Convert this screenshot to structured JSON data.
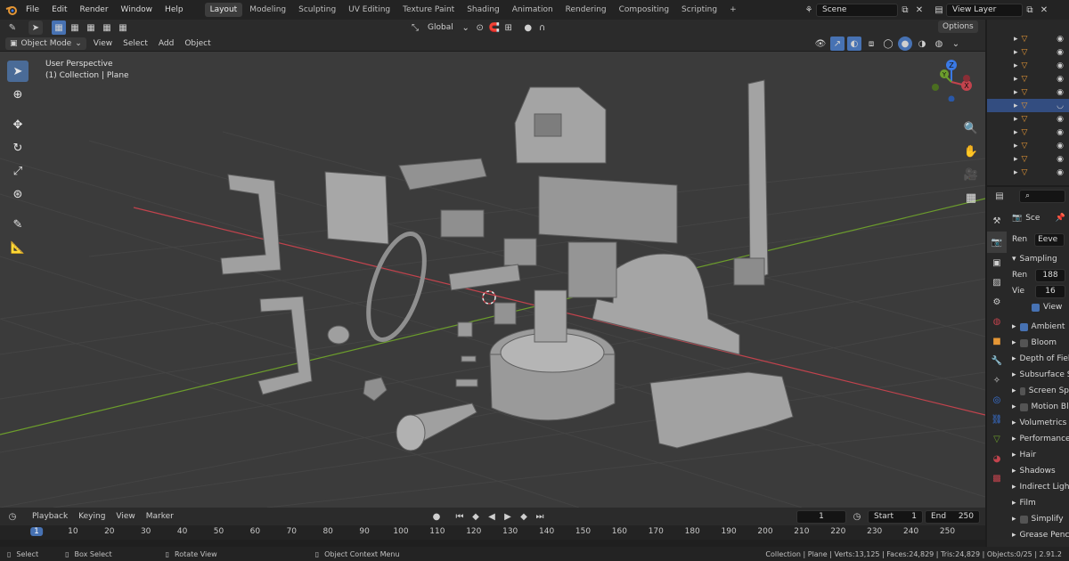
{
  "top_menu": [
    "File",
    "Edit",
    "Render",
    "Window",
    "Help"
  ],
  "workspaces": [
    {
      "label": "Layout",
      "active": true
    },
    {
      "label": "Modeling"
    },
    {
      "label": "Sculpting"
    },
    {
      "label": "UV Editing"
    },
    {
      "label": "Texture Paint"
    },
    {
      "label": "Shading"
    },
    {
      "label": "Animation"
    },
    {
      "label": "Rendering"
    },
    {
      "label": "Compositing"
    },
    {
      "label": "Scripting"
    }
  ],
  "add_workspace": "+",
  "scene": "Scene",
  "view_layer": "View Layer",
  "viewport_header": {
    "mode": "Object Mode",
    "menus": [
      "View",
      "Select",
      "Add",
      "Object"
    ],
    "transform_orientation": "Global",
    "options": "Options"
  },
  "overlay_text": {
    "perspective": "User Perspective",
    "collection": "(1) Collection | Plane"
  },
  "gizmo": {
    "x": "X",
    "y": "Y",
    "z": "Z"
  },
  "properties": {
    "tab_label": "Sce",
    "render_label": "Ren",
    "render_engine": "Eeve",
    "sampling_label": "Sampling",
    "render_samples_label": "Ren",
    "render_samples": "188",
    "viewport_samples_label": "Vie",
    "viewport_samples": "16",
    "viewport_denoise": "View",
    "sections": [
      {
        "label": "Ambient",
        "checkbox": true,
        "checked": true
      },
      {
        "label": "Bloom",
        "checkbox": true,
        "checked": false
      },
      {
        "label": "Depth of Fiel"
      },
      {
        "label": "Subsurface S"
      },
      {
        "label": "Screen Sp",
        "checkbox": true,
        "checked": false
      },
      {
        "label": "Motion Bl",
        "checkbox": true,
        "checked": false
      },
      {
        "label": "Volumetrics"
      },
      {
        "label": "Performance"
      },
      {
        "label": "Hair"
      },
      {
        "label": "Shadows"
      },
      {
        "label": "Indirect Light"
      },
      {
        "label": "Film"
      },
      {
        "label": "Simplify",
        "checkbox": true,
        "checked": false
      },
      {
        "label": "Grease Penc"
      }
    ]
  },
  "timeline": {
    "menus": [
      "Playback",
      "Keying",
      "View",
      "Marker"
    ],
    "current_frame": "1",
    "start_label": "Start",
    "start": "1",
    "end_label": "End",
    "end": "250",
    "ruler": [
      "1",
      "10",
      "20",
      "30",
      "40",
      "50",
      "60",
      "70",
      "80",
      "90",
      "100",
      "110",
      "120",
      "130",
      "140",
      "150",
      "160",
      "170",
      "180",
      "190",
      "200",
      "210",
      "220",
      "230",
      "240",
      "250"
    ]
  },
  "status_bar": {
    "select": "Select",
    "box_select": "Box Select",
    "rotate_view": "Rotate View",
    "context_menu": "Object Context Menu",
    "stats": "Collection | Plane | Verts:13,125 | Faces:24,829 | Tris:24,829 | Objects:0/25 | 2.91.2"
  },
  "colors": {
    "accent": "#4772b3",
    "orange": "#e59736",
    "axis_x": "#c2434d",
    "axis_y": "#6c9d2c",
    "axis_z": "#3a79e5"
  }
}
